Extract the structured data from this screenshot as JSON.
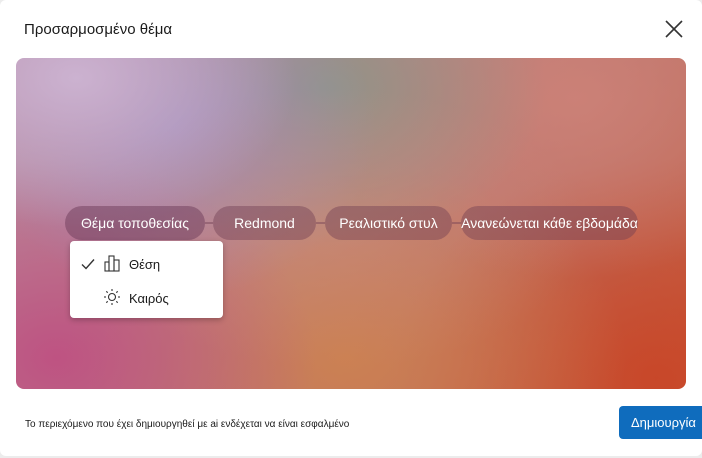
{
  "dialog": {
    "title": "Προσαρμοσμένο θέμα",
    "close_icon": "close-icon"
  },
  "chips": [
    {
      "label": "Θέμα τοποθεσίας"
    },
    {
      "label": "Redmond"
    },
    {
      "label": "Ρεαλιστικό στυλ"
    },
    {
      "label": "Ανανεώνεται κάθε εβδομάδα"
    }
  ],
  "dropdown": {
    "items": [
      {
        "label": "Θέση",
        "icon": "landmark-icon",
        "selected": true
      },
      {
        "label": "Καιρός",
        "icon": "sun-icon",
        "selected": false
      }
    ]
  },
  "footer": {
    "disclaimer": "Το περιεχόμενο που έχει δημιουργηθεί με ai ενδέχεται να είναι εσφαλμένο",
    "create_label": "Δημιουργία"
  },
  "colors": {
    "accent": "#0f6cbd"
  }
}
